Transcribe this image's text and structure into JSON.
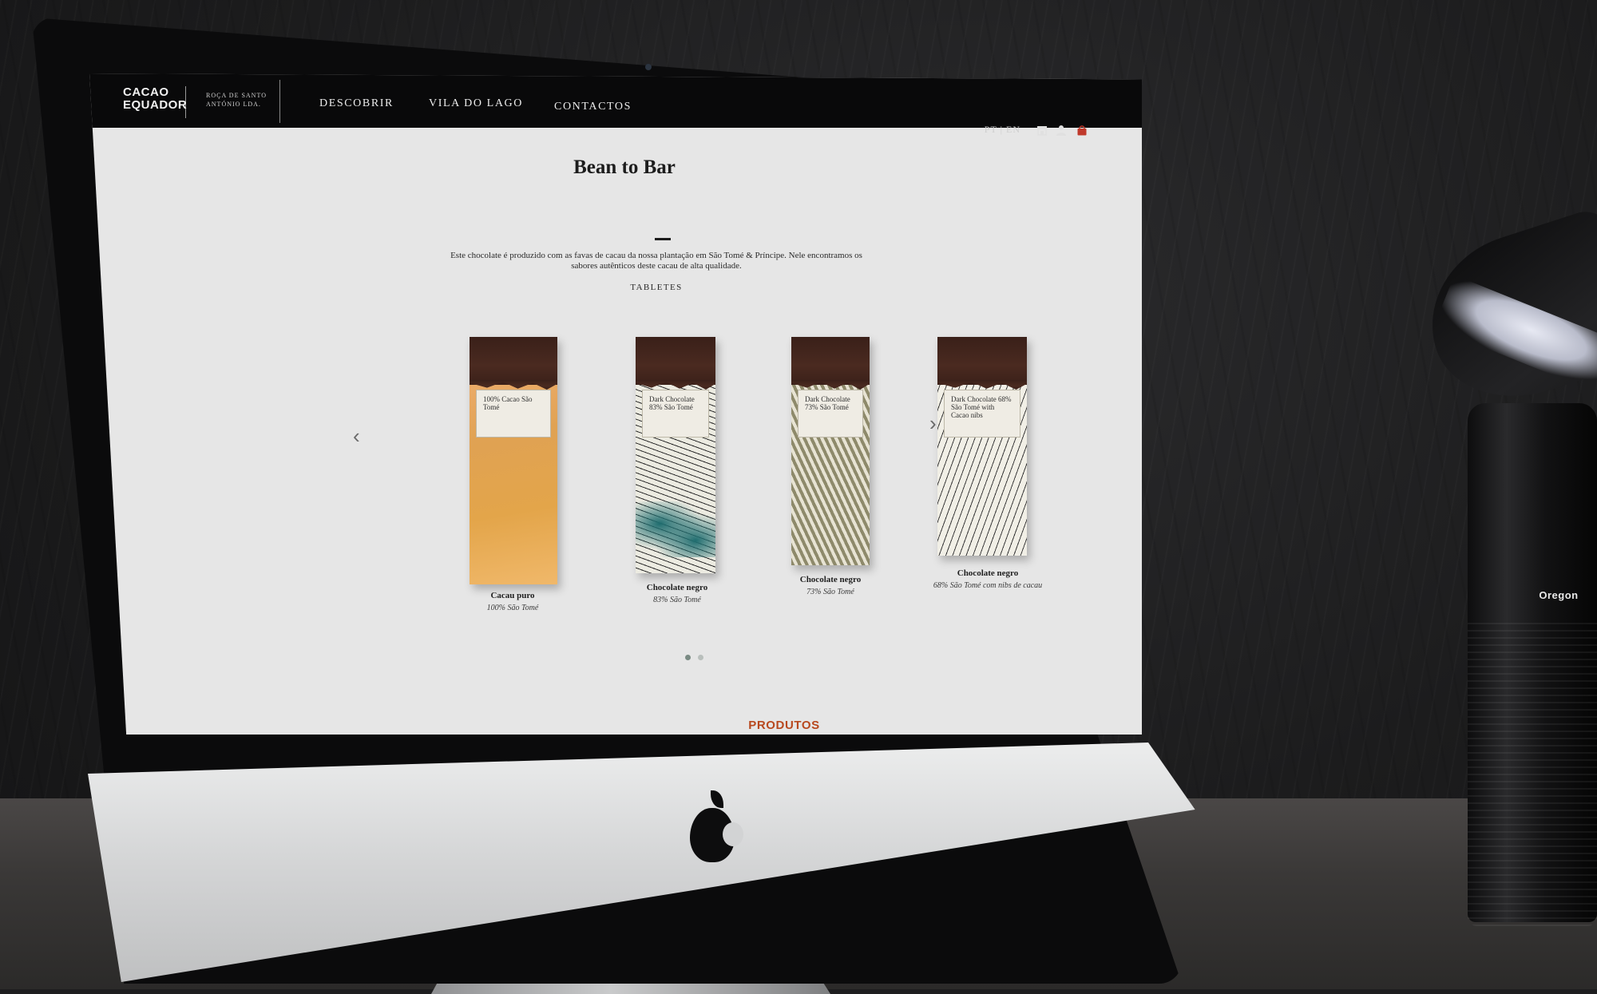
{
  "scene": {
    "lamp_brand": "Oregon"
  },
  "header": {
    "logo_line1": "CACAO",
    "logo_line2": "EQUADOR",
    "logo_sub_line1": "ROÇA DE SANTO",
    "logo_sub_line2": "ANTÓNIO LDA.",
    "nav": [
      "DESCOBRIR",
      "VILA DO LAGO",
      "CONTACTOS"
    ],
    "lang_pt": "PT",
    "lang_sep": "|",
    "lang_en": "EN",
    "icons": [
      "store-icon",
      "user-icon",
      "bag-icon"
    ]
  },
  "main": {
    "title": "Bean to Bar",
    "description": "Este chocolate é produzido com as favas de cacau da nossa plantação em São Tomé & Príncipe. Nele encontramos os sabores autênticos deste cacau de alta qualidade.",
    "section_label": "TABLETES",
    "arrow_left": "‹",
    "arrow_right": "›",
    "products": [
      {
        "name": "Cacau puro",
        "variant": "100% São Tomé",
        "pack_label": "100% Cacao São Tomé"
      },
      {
        "name": "Chocolate negro",
        "variant": "83% São Tomé",
        "pack_label": "Dark Chocolate 83% São Tomé"
      },
      {
        "name": "Chocolate negro",
        "variant": "73% São Tomé",
        "pack_label": "Dark Chocolate 73% São Tomé"
      },
      {
        "name": "Chocolate negro",
        "variant": "68% São Tomé com nibs de cacau",
        "pack_label": "Dark Chocolate 68% São Tomé with Cacao nibs"
      }
    ],
    "pagination_dots": 2,
    "active_dot": 1,
    "produtos": "PRODUTOS"
  },
  "colors": {
    "header_bg": "#09090a",
    "page_bg": "#e6e6e6",
    "accent": "#b8481e"
  }
}
